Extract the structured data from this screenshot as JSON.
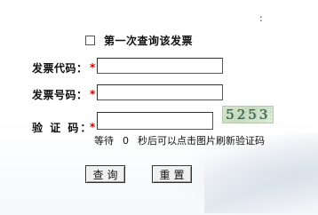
{
  "top_colon": ":",
  "first_query": {
    "label": "第一次查询该发票",
    "checked": false
  },
  "fields": {
    "invoice_code": {
      "label": "发票代码：",
      "required_mark": "*",
      "value": ""
    },
    "invoice_number": {
      "label": "发票号码：",
      "required_mark": "*",
      "value": ""
    },
    "verify_code": {
      "label": "验 证 码：",
      "required_mark": "*",
      "value": ""
    }
  },
  "captcha": {
    "text": "5253"
  },
  "wait": {
    "prefix": "等待",
    "seconds": "0",
    "suffix": "秒后可以点击图片刷新验证码"
  },
  "buttons": {
    "query": "查询",
    "reset": "重置"
  },
  "colors": {
    "required": "#cc0000",
    "captcha_text": "#2f5d4a",
    "captcha_bg": "#d9e8d2"
  }
}
